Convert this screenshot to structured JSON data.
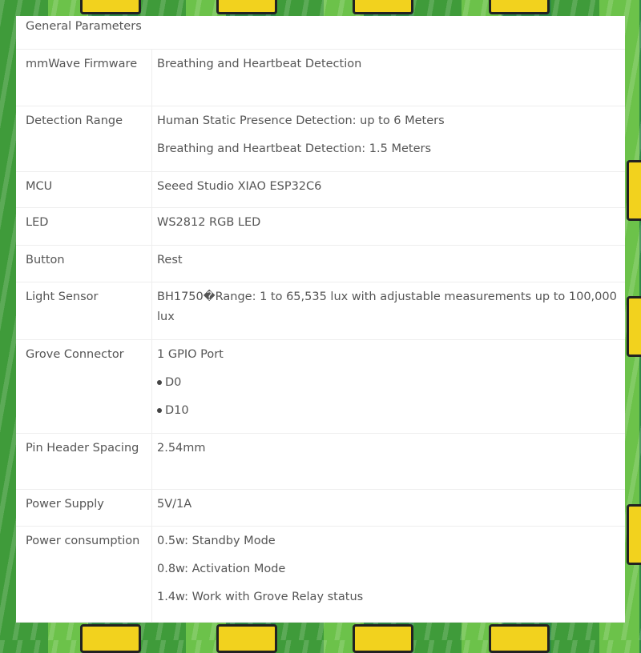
{
  "title": "General Parameters",
  "rows": [
    {
      "label": "mmWave Firmware",
      "values": [
        "Breathing and Heartbeat Detection"
      ]
    },
    {
      "label": "Detection Range",
      "values": [
        "Human Static Presence Detection: up to 6 Meters",
        "Breathing and Heartbeat Detection: 1.5 Meters"
      ]
    },
    {
      "label": "MCU",
      "values": [
        "Seeed Studio XIAO ESP32C6"
      ]
    },
    {
      "label": "LED",
      "values": [
        "WS2812 RGB LED"
      ]
    },
    {
      "label": "Button",
      "values": [
        "Rest"
      ]
    },
    {
      "label": "Light Sensor",
      "values": [
        "BH1750�Range: 1 to 65,535 lux with adjustable measurements up to 100,000 lux"
      ]
    },
    {
      "label": "Grove Connector",
      "values": [
        "1 GPIO Port",
        "D0",
        "D10"
      ]
    },
    {
      "label": "Pin Header Spacing",
      "values": [
        "2.54mm"
      ]
    },
    {
      "label": "Power Supply",
      "values": [
        "5V/1A"
      ]
    },
    {
      "label": "Power consumption",
      "values": [
        "0.5w: Standby Mode",
        "0.8w: Activation Mode",
        "1.4w: Work with Grove Relay status"
      ]
    }
  ]
}
